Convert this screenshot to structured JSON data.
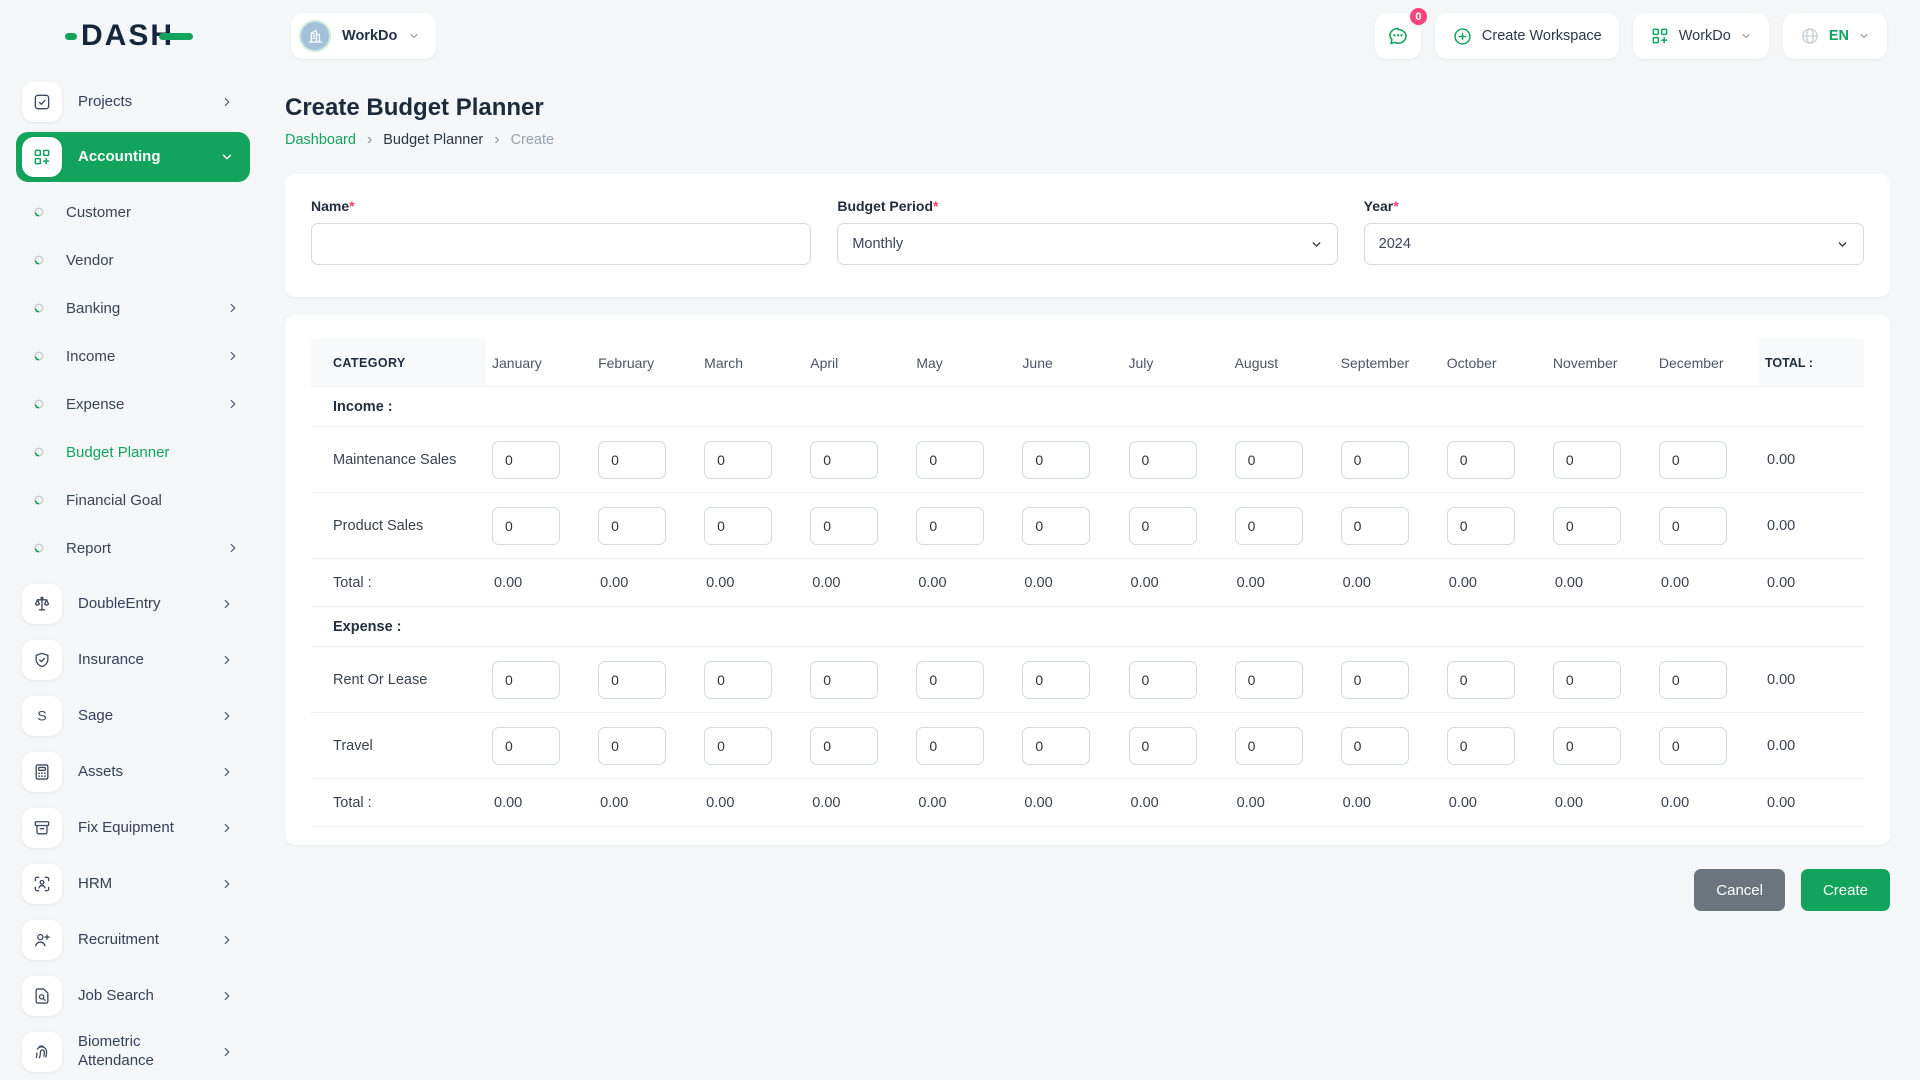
{
  "brand": {
    "logo_text": "DASH"
  },
  "colors": {
    "primary": "#12a45c",
    "badge": "#f8467b",
    "cancel_button": "#6c757d"
  },
  "header": {
    "workspace": {
      "label": "WorkDo",
      "avatar_icon": "building-icon"
    },
    "messages": {
      "badge_count": "0",
      "icon": "chat-icon"
    },
    "create_workspace_label": "Create Workspace",
    "app_menu_label": "WorkDo",
    "language_label": "EN"
  },
  "sidebar": {
    "items": [
      {
        "label": "Projects",
        "icon": "checkbox",
        "chevron": "right"
      },
      {
        "label": "Accounting",
        "icon": "grid-plus",
        "active": true,
        "chevron": "down",
        "children": [
          {
            "label": "Customer"
          },
          {
            "label": "Vendor"
          },
          {
            "label": "Banking",
            "chevron": "right"
          },
          {
            "label": "Income",
            "chevron": "right"
          },
          {
            "label": "Expense",
            "chevron": "right"
          },
          {
            "label": "Budget Planner",
            "active": true
          },
          {
            "label": "Financial Goal"
          },
          {
            "label": "Report",
            "chevron": "right"
          }
        ]
      },
      {
        "label": "DoubleEntry",
        "icon": "scales",
        "chevron": "right"
      },
      {
        "label": "Insurance",
        "icon": "shield-check",
        "chevron": "right"
      },
      {
        "label": "Sage",
        "icon": "letter-s",
        "chevron": "right"
      },
      {
        "label": "Assets",
        "icon": "calculator",
        "chevron": "right"
      },
      {
        "label": "Fix Equipment",
        "icon": "archive",
        "chevron": "right"
      },
      {
        "label": "HRM",
        "icon": "user-scan",
        "chevron": "right"
      },
      {
        "label": "Recruitment",
        "icon": "user-plus",
        "chevron": "right"
      },
      {
        "label": "Job Search",
        "icon": "file-search",
        "chevron": "right"
      },
      {
        "label": "Biometric Attendance",
        "icon": "fingerprint",
        "chevron": "right"
      }
    ]
  },
  "page": {
    "title": "Create Budget Planner",
    "breadcrumb_separator": "›",
    "breadcrumb": [
      {
        "label": "Dashboard",
        "type": "link"
      },
      {
        "label": "Budget Planner",
        "type": "text"
      },
      {
        "label": "Create",
        "type": "current"
      }
    ]
  },
  "form": {
    "name": {
      "label": "Name",
      "required": "*",
      "value": ""
    },
    "budget_period": {
      "label": "Budget Period",
      "required": "*",
      "value": "Monthly"
    },
    "year": {
      "label": "Year",
      "required": "*",
      "value": "2024"
    }
  },
  "budget_table": {
    "category_header": "CATEGORY",
    "months": [
      "January",
      "February",
      "March",
      "April",
      "May",
      "June",
      "July",
      "August",
      "September",
      "October",
      "November",
      "December"
    ],
    "total_header": "TOTAL :",
    "sections": [
      {
        "title": "Income :",
        "rows": [
          {
            "label": "Maintenance Sales",
            "values": [
              "0",
              "0",
              "0",
              "0",
              "0",
              "0",
              "0",
              "0",
              "0",
              "0",
              "0",
              "0"
            ],
            "total": "0.00"
          },
          {
            "label": "Product Sales",
            "values": [
              "0",
              "0",
              "0",
              "0",
              "0",
              "0",
              "0",
              "0",
              "0",
              "0",
              "0",
              "0"
            ],
            "total": "0.00"
          }
        ],
        "total_row": {
          "label": "Total :",
          "values": [
            "0.00",
            "0.00",
            "0.00",
            "0.00",
            "0.00",
            "0.00",
            "0.00",
            "0.00",
            "0.00",
            "0.00",
            "0.00",
            "0.00"
          ],
          "total": "0.00"
        }
      },
      {
        "title": "Expense :",
        "rows": [
          {
            "label": "Rent Or Lease",
            "values": [
              "0",
              "0",
              "0",
              "0",
              "0",
              "0",
              "0",
              "0",
              "0",
              "0",
              "0",
              "0"
            ],
            "total": "0.00"
          },
          {
            "label": "Travel",
            "values": [
              "0",
              "0",
              "0",
              "0",
              "0",
              "0",
              "0",
              "0",
              "0",
              "0",
              "0",
              "0"
            ],
            "total": "0.00"
          }
        ],
        "total_row": {
          "label": "Total :",
          "values": [
            "0.00",
            "0.00",
            "0.00",
            "0.00",
            "0.00",
            "0.00",
            "0.00",
            "0.00",
            "0.00",
            "0.00",
            "0.00",
            "0.00"
          ],
          "total": "0.00"
        }
      }
    ]
  },
  "actions": {
    "cancel_label": "Cancel",
    "create_label": "Create"
  }
}
